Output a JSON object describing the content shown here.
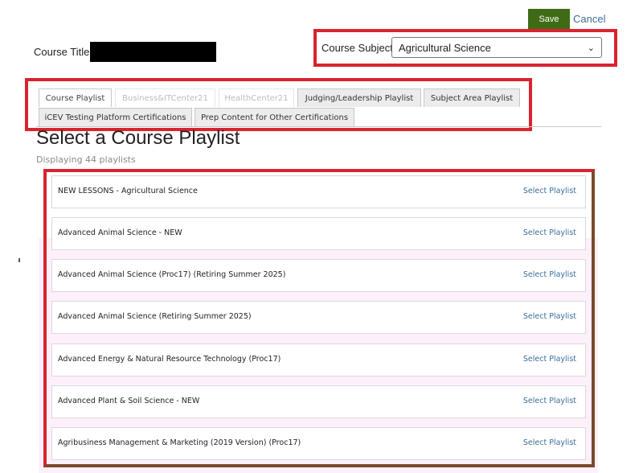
{
  "toolbar": {
    "save_label": "Save",
    "cancel_label": "Cancel"
  },
  "course_title": {
    "label": "Course Title:"
  },
  "course_subject": {
    "label": "Course Subject:",
    "selected": "Agricultural Science"
  },
  "tabs": [
    {
      "label": "Course Playlist",
      "state": "active"
    },
    {
      "label": "Business&ITCenter21",
      "state": "disabled"
    },
    {
      "label": "HealthCenter21",
      "state": "disabled"
    },
    {
      "label": "Judging/Leadership Playlist",
      "state": "normal"
    },
    {
      "label": "Subject Area Playlist",
      "state": "normal"
    },
    {
      "label": "iCEV Testing Platform Certifications",
      "state": "normal"
    },
    {
      "label": "Prep Content for Other Certifications",
      "state": "normal"
    }
  ],
  "main": {
    "title": "Select a Course Playlist",
    "count_text": "Displaying 44 playlists"
  },
  "playlists": [
    {
      "name": "NEW LESSONS - Agricultural Science",
      "action": "Select Playlist"
    },
    {
      "name": "Advanced Animal Science - NEW",
      "action": "Select Playlist"
    },
    {
      "name": "Advanced Animal Science (Proc17) (Retiring Summer 2025)",
      "action": "Select Playlist"
    },
    {
      "name": "Advanced Animal Science (Retiring Summer 2025)",
      "action": "Select Playlist"
    },
    {
      "name": "Advanced Energy & Natural Resource Technology (Proc17)",
      "action": "Select Playlist"
    },
    {
      "name": "Advanced Plant & Soil Science - NEW",
      "action": "Select Playlist"
    },
    {
      "name": "Agribusiness Management & Marketing (2019 Version) (Proc17)",
      "action": "Select Playlist"
    }
  ],
  "colors": {
    "save_bg": "#3f6b16",
    "link": "#3a6f9a",
    "highlight": "#d9232e"
  }
}
